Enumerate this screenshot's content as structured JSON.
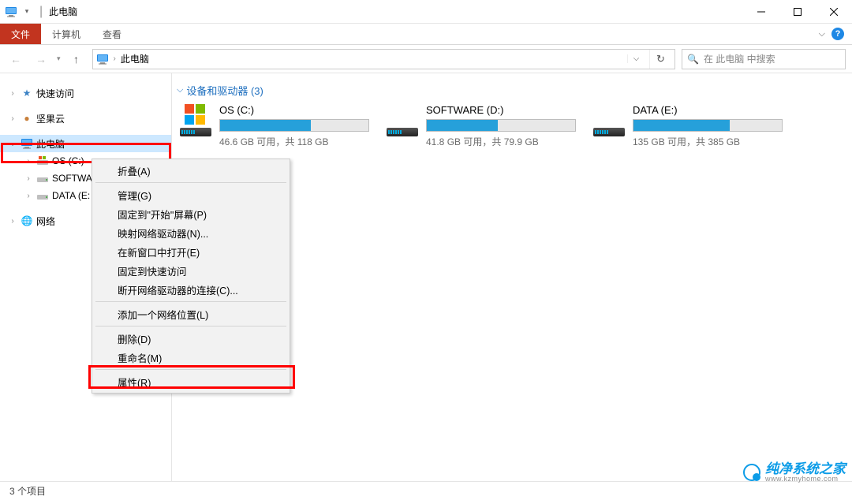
{
  "title": "此电脑",
  "ribbon": {
    "file": "文件",
    "computer": "计算机",
    "view": "查看"
  },
  "address": {
    "location": "此电脑"
  },
  "search": {
    "placeholder": "在 此电脑 中搜索"
  },
  "sidebar": {
    "quick_access": "快速访问",
    "jianguoyun": "坚果云",
    "this_pc": "此电脑",
    "os_c": "OS (C:)",
    "software": "SOFTWA…",
    "data": "DATA (E:",
    "network": "网络"
  },
  "section": {
    "title": "设备和驱动器 (3)"
  },
  "drives": [
    {
      "name": "OS (C:)",
      "free": "46.6 GB 可用，共 118 GB",
      "pct": 61
    },
    {
      "name": "SOFTWARE (D:)",
      "free": "41.8 GB 可用，共 79.9 GB",
      "pct": 48
    },
    {
      "name": "DATA (E:)",
      "free": "135 GB 可用，共 385 GB",
      "pct": 65
    }
  ],
  "context_menu": {
    "collapse": "折叠(A)",
    "manage": "管理(G)",
    "pin_start": "固定到\"开始\"屏幕(P)",
    "map_drive": "映射网络驱动器(N)...",
    "open_new": "在新窗口中打开(E)",
    "pin_quick": "固定到快速访问",
    "disconnect": "断开网络驱动器的连接(C)...",
    "add_location": "添加一个网络位置(L)",
    "delete": "删除(D)",
    "rename": "重命名(M)",
    "properties": "属性(R)"
  },
  "status": "3 个项目",
  "watermark": {
    "title": "纯净系统之家",
    "url": "www.kzmyhome.com"
  }
}
